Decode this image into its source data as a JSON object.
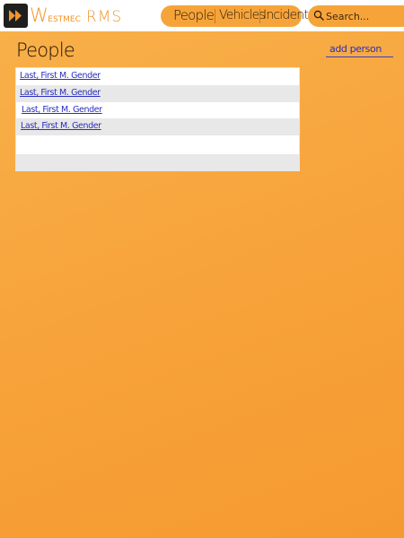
{
  "app": {
    "brand_prefix": "W",
    "brand_rest": "estmec",
    "brand_suffix": "RMS"
  },
  "nav": {
    "items": [
      {
        "label": "People"
      },
      {
        "label": "Vehicles"
      },
      {
        "label": "Incidents"
      }
    ]
  },
  "search": {
    "placeholder": "Search..."
  },
  "page": {
    "title": "People",
    "add_label": "add person"
  },
  "people": {
    "rows": [
      {
        "label": "Last, First M. Gender"
      },
      {
        "label": "Last, First M. Gender"
      },
      {
        "label": "Last, First M. Gender"
      },
      {
        "label": "Last, First M. Gender"
      },
      {
        "label": ""
      },
      {
        "label": ""
      }
    ]
  },
  "colors": {
    "accent": "#f6a43a",
    "background": "#f7a23a",
    "link": "#2a2fbf"
  }
}
